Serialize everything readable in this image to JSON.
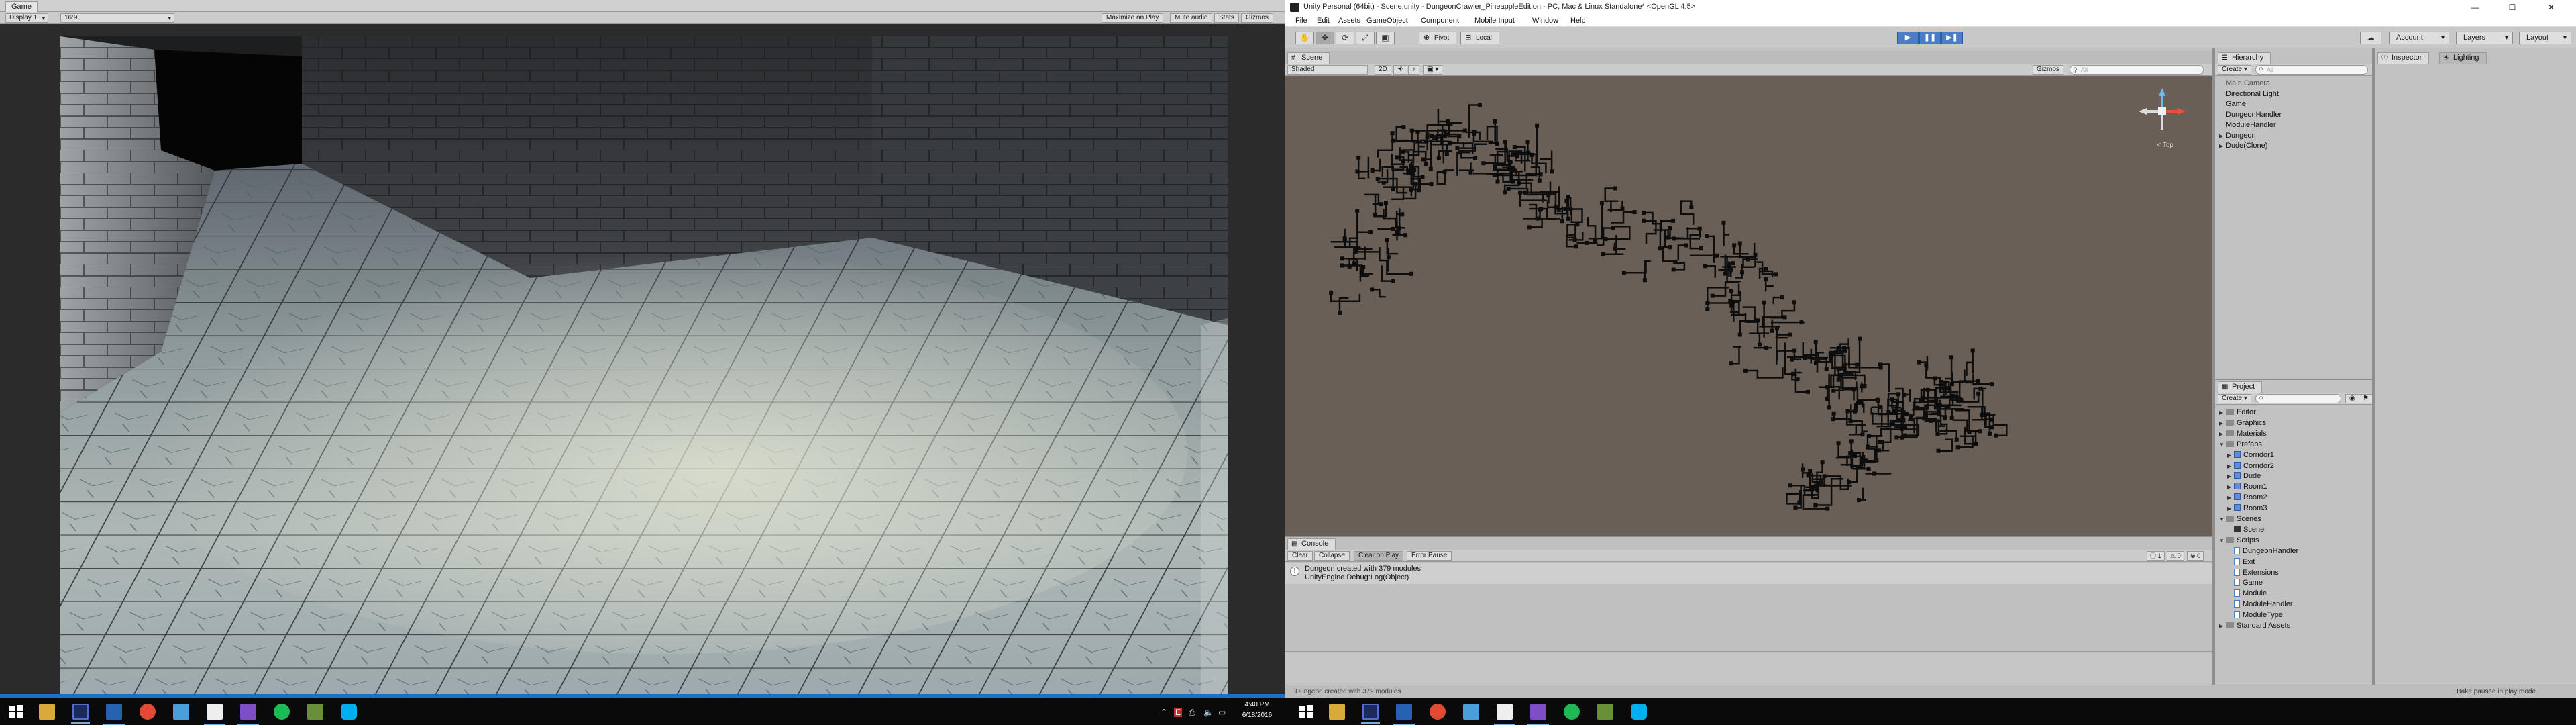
{
  "game_window": {
    "tab_label": "Game",
    "display_dropdown": "Display 1",
    "aspect_dropdown": "16:9",
    "toggles": [
      "Maximize on Play",
      "Mute audio",
      "Stats",
      "Gizmos"
    ]
  },
  "editor": {
    "title": "Unity Personal (64bit) - Scene.unity - DungeonCrawler_PineappleEdition - PC, Mac & Linux Standalone* <OpenGL 4.5>",
    "window_controls": {
      "minimize": "—",
      "maximize": "☐",
      "close": "✕"
    },
    "menu": [
      "File",
      "Edit",
      "Assets",
      "GameObject",
      "Component",
      "Mobile Input",
      "Window",
      "Help"
    ],
    "toolbar": {
      "pivot_label": "Pivot",
      "space_label": "Local",
      "account_label": "Account",
      "layers_label": "Layers",
      "layout_label": "Layout",
      "play_state": "playing"
    },
    "scene": {
      "tab_label": "Scene",
      "shading_mode": "Shaded",
      "mode_2d": "2D",
      "gizmos_label": "Gizmos",
      "search_placeholder": "All",
      "gizmo_label": "< Top"
    },
    "console": {
      "tab_label": "Console",
      "buttons": [
        "Clear",
        "Collapse",
        "Clear on Play",
        "Error Pause"
      ],
      "counts": [
        "1",
        "0",
        "0"
      ],
      "entry_line1": "Dungeon created with 379 modules",
      "entry_line2": "UnityEngine.Debug:Log(Object)"
    },
    "hierarchy": {
      "tab_label": "Hierarchy",
      "create_label": "Create",
      "search_placeholder": "All",
      "items": [
        {
          "label": "Main Camera",
          "dim": true,
          "arrow": ""
        },
        {
          "label": "Directional Light",
          "dim": false,
          "arrow": ""
        },
        {
          "label": "Game",
          "dim": false,
          "arrow": ""
        },
        {
          "label": "DungeonHandler",
          "dim": false,
          "arrow": ""
        },
        {
          "label": "ModuleHandler",
          "dim": false,
          "arrow": ""
        },
        {
          "label": "Dungeon",
          "dim": false,
          "arrow": "▶"
        },
        {
          "label": "Dude(Clone)",
          "dim": false,
          "arrow": "▶"
        }
      ]
    },
    "project": {
      "tab_label": "Project",
      "create_label": "Create",
      "search_placeholder": "",
      "items": [
        {
          "label": "Editor",
          "type": "folder",
          "indent": 0,
          "arrow": "▶"
        },
        {
          "label": "Graphics",
          "type": "folder",
          "indent": 0,
          "arrow": "▶"
        },
        {
          "label": "Materials",
          "type": "folder",
          "indent": 0,
          "arrow": "▶"
        },
        {
          "label": "Prefabs",
          "type": "folder",
          "indent": 0,
          "arrow": "▼"
        },
        {
          "label": "Corridor1",
          "type": "prefab",
          "indent": 1,
          "arrow": "▶"
        },
        {
          "label": "Corridor2",
          "type": "prefab",
          "indent": 1,
          "arrow": "▶"
        },
        {
          "label": "Dude",
          "type": "prefab",
          "indent": 1,
          "arrow": "▶"
        },
        {
          "label": "Room1",
          "type": "prefab",
          "indent": 1,
          "arrow": "▶"
        },
        {
          "label": "Room2",
          "type": "prefab",
          "indent": 1,
          "arrow": "▶"
        },
        {
          "label": "Room3",
          "type": "prefab",
          "indent": 1,
          "arrow": "▶"
        },
        {
          "label": "Scenes",
          "type": "folder",
          "indent": 0,
          "arrow": "▼"
        },
        {
          "label": "Scene",
          "type": "scene",
          "indent": 1,
          "arrow": ""
        },
        {
          "label": "Scripts",
          "type": "folder",
          "indent": 0,
          "arrow": "▼"
        },
        {
          "label": "DungeonHandler",
          "type": "script",
          "indent": 1,
          "arrow": ""
        },
        {
          "label": "Exit",
          "type": "script",
          "indent": 1,
          "arrow": ""
        },
        {
          "label": "Extensions",
          "type": "script",
          "indent": 1,
          "arrow": ""
        },
        {
          "label": "Game",
          "type": "script",
          "indent": 1,
          "arrow": ""
        },
        {
          "label": "Module",
          "type": "script",
          "indent": 1,
          "arrow": ""
        },
        {
          "label": "ModuleHandler",
          "type": "script",
          "indent": 1,
          "arrow": ""
        },
        {
          "label": "ModuleType",
          "type": "script",
          "indent": 1,
          "arrow": ""
        },
        {
          "label": "Standard Assets",
          "type": "folder",
          "indent": 0,
          "arrow": "▶"
        }
      ]
    },
    "inspector": {
      "tab_label": "Inspector",
      "lighting_tab_label": "Lighting"
    },
    "status_bar": {
      "message": "Dungeon created with 379 modules",
      "right": "Bake paused in play mode"
    }
  },
  "taskbar": {
    "clock_time": "4:40 PM",
    "clock_date": "6/18/2016",
    "icons": [
      "windows-start",
      "task-view",
      "file-explorer",
      "unity",
      "visual-studio",
      "chrome",
      "unity",
      "visual-studio",
      "spotify",
      "minecraft",
      "skype"
    ]
  },
  "colors": {
    "accent_blue": "#1f6fc4",
    "scene_background": "#695f57",
    "play_button": "#4d7cc6"
  }
}
